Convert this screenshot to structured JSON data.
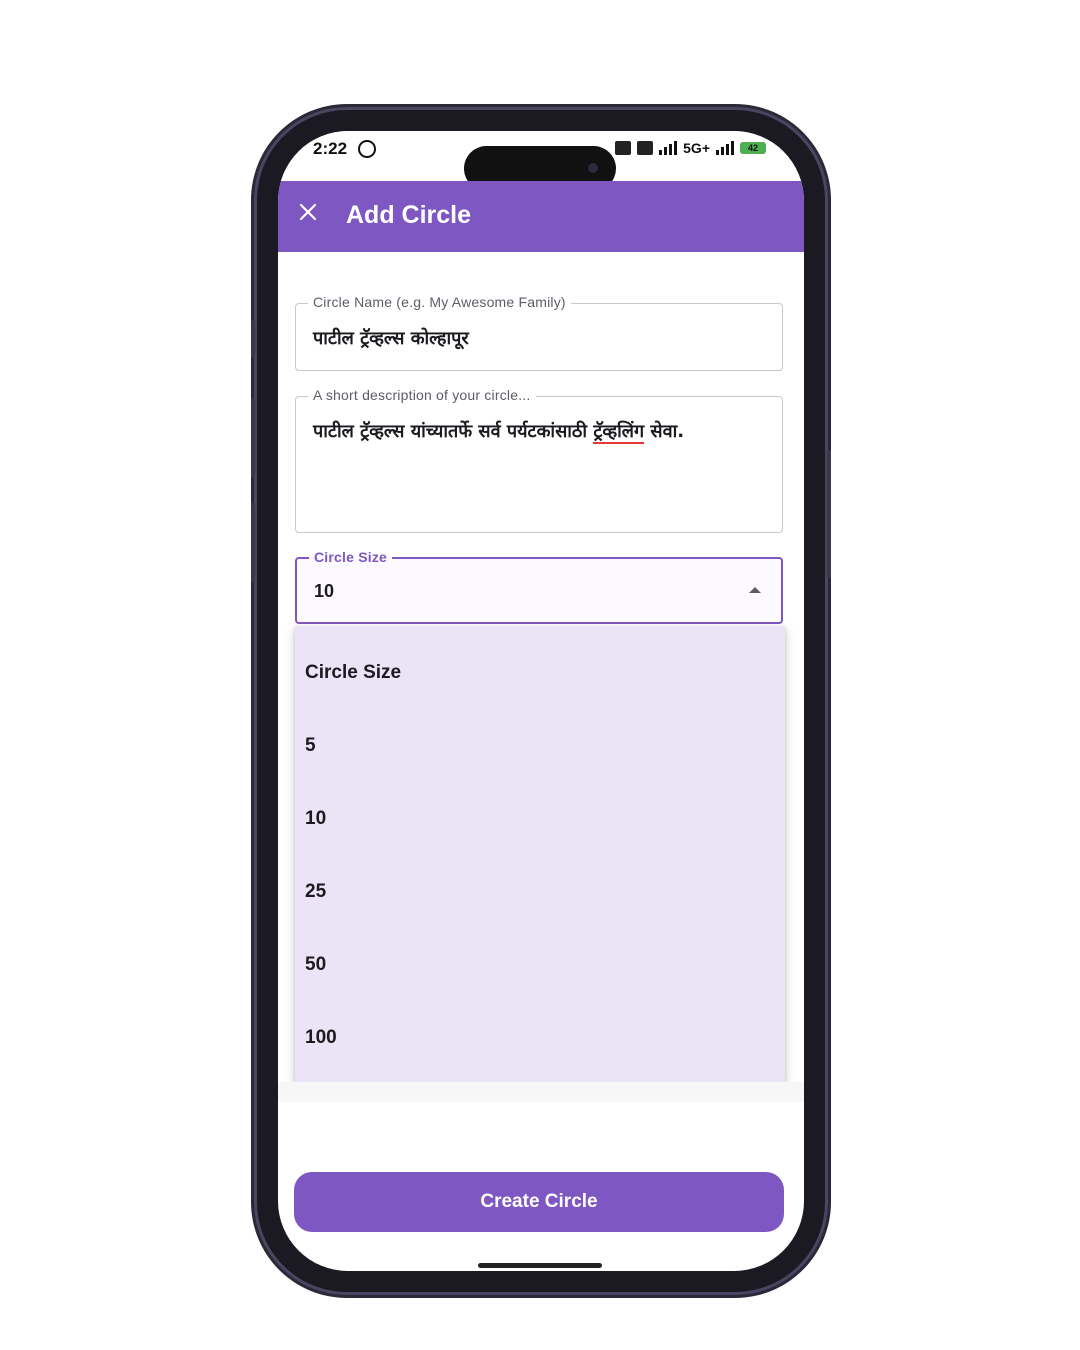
{
  "status_bar": {
    "time": "2:22",
    "network": "5G+",
    "battery": "42"
  },
  "app_bar": {
    "title": "Add Circle"
  },
  "form": {
    "name_field": {
      "label": "Circle Name (e.g. My Awesome Family)",
      "value": "पाटील ट्रॅव्हल्स कोल्हापूर"
    },
    "description_field": {
      "label": "A short description of your circle...",
      "value_before": "पाटील ट्रॅव्हल्स यांच्यातर्फे सर्व पर्यटकांसाठी ",
      "value_misspelled": "ट्रॅव्हलिंग",
      "value_after": " सेवा."
    },
    "size_field": {
      "label": "Circle Size",
      "value": "10"
    }
  },
  "dropdown": {
    "header": "Circle Size",
    "options": [
      "5",
      "10",
      "25",
      "50",
      "100"
    ]
  },
  "actions": {
    "create_label": "Create Circle"
  },
  "colors": {
    "primary": "#7e57c2",
    "menu_background": "#ebe3f6",
    "spell_error": "#e53935"
  },
  "icons": {
    "close": "close-icon",
    "whatsapp": "whatsapp-icon",
    "dropdown": "arrow-up-icon"
  }
}
